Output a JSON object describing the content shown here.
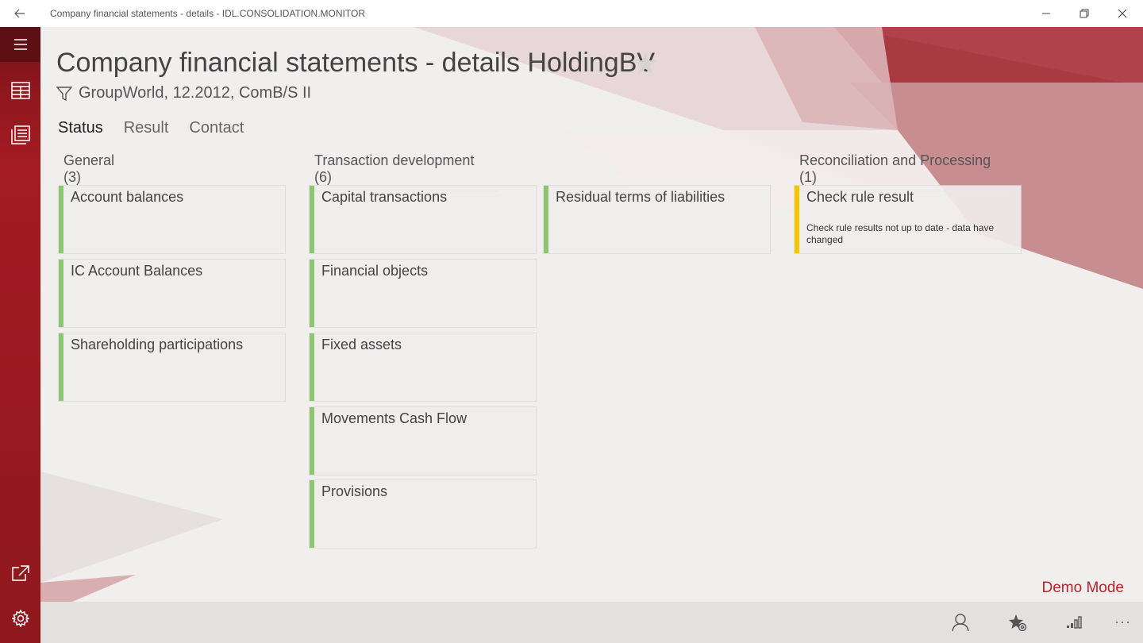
{
  "window": {
    "title": "Company financial statements - details - IDL.CONSOLIDATION.MONITOR"
  },
  "header": {
    "title": "Company financial statements - details",
    "entity": "HoldingBV",
    "filter": "GroupWorld, 12.2012, ComB/S II"
  },
  "tabs": [
    {
      "label": "Status",
      "active": true
    },
    {
      "label": "Result",
      "active": false
    },
    {
      "label": "Contact",
      "active": false
    }
  ],
  "groups": {
    "general": {
      "heading": "General (3)",
      "tiles": [
        {
          "title": "Account balances",
          "status": "ok"
        },
        {
          "title": "IC Account Balances",
          "status": "ok"
        },
        {
          "title": "Shareholding participations",
          "status": "ok"
        }
      ]
    },
    "transaction": {
      "heading": "Transaction development (6)",
      "tiles": [
        {
          "title": "Capital transactions",
          "status": "ok"
        },
        {
          "title": "Financial objects",
          "status": "ok"
        },
        {
          "title": "Fixed assets",
          "status": "ok"
        },
        {
          "title": "Movements Cash Flow",
          "status": "ok"
        },
        {
          "title": "Provisions",
          "status": "ok"
        },
        {
          "title": "Residual terms of liabilities",
          "status": "ok"
        }
      ]
    },
    "reconciliation": {
      "heading": "Reconciliation and Processing (1)",
      "tiles": [
        {
          "title": "Check rule result",
          "status": "warning",
          "note": "Check rule results not  up to date - data have changed"
        }
      ]
    }
  },
  "footer": {
    "demo_mode": "Demo Mode"
  },
  "colors": {
    "accent_red": "#a41b23",
    "status_ok": "#8cc770",
    "status_warning": "#f6c500",
    "demo_text": "#b4252d"
  },
  "icons": {
    "back": "back-arrow-icon",
    "minimize": "minimize-icon",
    "restore": "restore-icon",
    "close": "close-icon",
    "menu": "hamburger-icon",
    "dashboard": "dashboard-icon",
    "reports": "reports-icon",
    "open_external": "open-external-icon",
    "settings": "gear-icon",
    "favorite": "star-icon",
    "filter": "filter-icon",
    "user": "user-icon",
    "favorites_manage": "star-settings-icon",
    "signal": "signal-icon",
    "more": "more-icon"
  }
}
